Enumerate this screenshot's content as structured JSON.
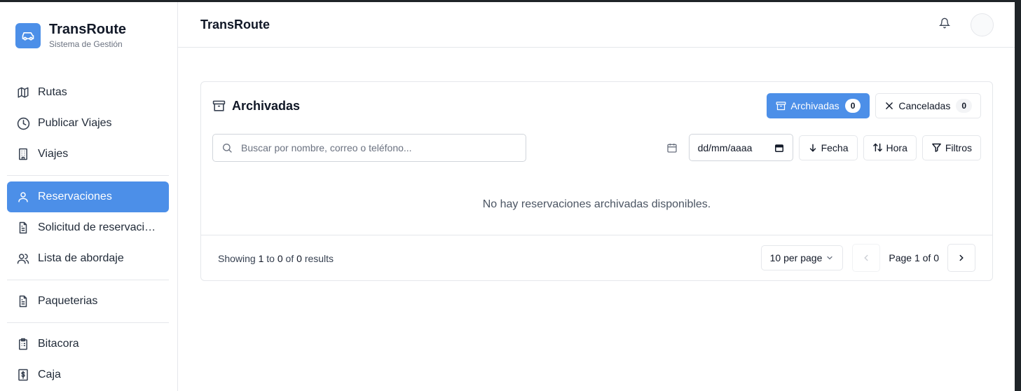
{
  "brand": {
    "title": "TransRoute",
    "subtitle": "Sistema de Gestión"
  },
  "sidebar": {
    "items": [
      {
        "label": "Rutas",
        "icon": "map-icon"
      },
      {
        "label": "Publicar Viajes",
        "icon": "clock-icon"
      },
      {
        "label": "Viajes",
        "icon": "building-icon"
      },
      {
        "label": "Reservaciones",
        "icon": "user-icon",
        "active": true
      },
      {
        "label": "Solicitud de reservaciones",
        "icon": "file-icon"
      },
      {
        "label": "Lista de abordaje",
        "icon": "users-icon"
      },
      {
        "label": "Paqueterias",
        "icon": "file-icon"
      },
      {
        "label": "Bitacora",
        "icon": "clipboard-icon"
      },
      {
        "label": "Caja",
        "icon": "dollar-icon"
      }
    ]
  },
  "header": {
    "title": "TransRoute"
  },
  "card": {
    "title": "Archivadas",
    "tabs": [
      {
        "label": "Archivadas",
        "count": "0",
        "icon": "archive-icon",
        "active": true
      },
      {
        "label": "Canceladas",
        "count": "0",
        "icon": "close-icon",
        "active": false
      }
    ],
    "search": {
      "placeholder": "Buscar por nombre, correo o teléfono...",
      "value": ""
    },
    "date": {
      "placeholder": "dd/mm/aaaa"
    },
    "buttons": {
      "fecha": "Fecha",
      "hora": "Hora",
      "filtros": "Filtros"
    },
    "empty_message": "No hay reservaciones archivadas disponibles.",
    "footer": {
      "showing_prefix": "Showing",
      "from": "1",
      "to_word": "to",
      "to": "0",
      "of_word": "of",
      "total": "0",
      "results_word": "results",
      "per_page": "10 per page",
      "page_text": "Page 1 of 0"
    }
  },
  "colors": {
    "accent": "#4c8fe8",
    "border": "#e5e7eb",
    "text_muted": "#6b7280"
  }
}
